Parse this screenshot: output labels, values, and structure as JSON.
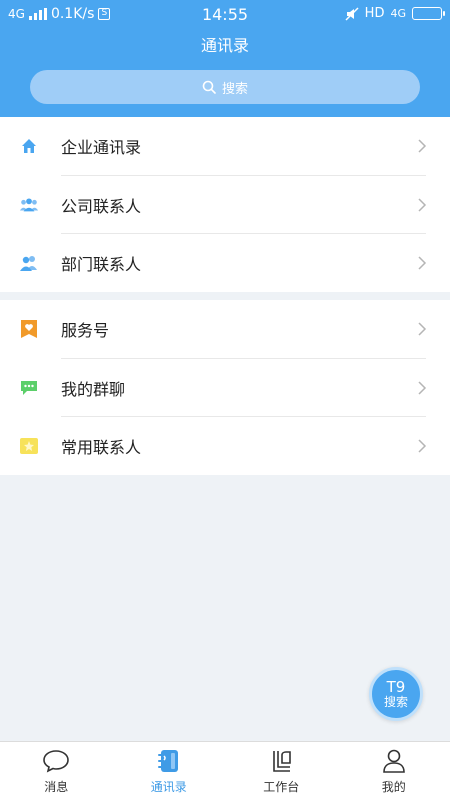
{
  "status_bar": {
    "network": "4G",
    "speed": "0.1K/s",
    "sim": "S",
    "time": "14:55",
    "hd": "HD",
    "net_right": "4G"
  },
  "header": {
    "title": "通讯录",
    "search_placeholder": "搜索"
  },
  "sections": [
    {
      "items": [
        {
          "label": "企业通讯录",
          "icon": "home-icon"
        },
        {
          "label": "公司联系人",
          "icon": "group-icon"
        },
        {
          "label": "部门联系人",
          "icon": "people-icon"
        }
      ]
    },
    {
      "items": [
        {
          "label": "服务号",
          "icon": "service-heart-icon"
        },
        {
          "label": "我的群聊",
          "icon": "chat-bubble-icon"
        },
        {
          "label": "常用联系人",
          "icon": "star-contact-icon"
        }
      ]
    }
  ],
  "t9_button": {
    "top": "T9",
    "bottom": "搜索"
  },
  "bottom_nav": [
    {
      "label": "消息",
      "icon": "message-icon",
      "active": false
    },
    {
      "label": "通讯录",
      "icon": "contacts-book-icon",
      "active": true
    },
    {
      "label": "工作台",
      "icon": "workbench-icon",
      "active": false
    },
    {
      "label": "我的",
      "icon": "profile-icon",
      "active": false
    }
  ],
  "colors": {
    "primary": "#4aa6f0",
    "background": "#eef2f6",
    "active_tab": "#3f9be6"
  }
}
